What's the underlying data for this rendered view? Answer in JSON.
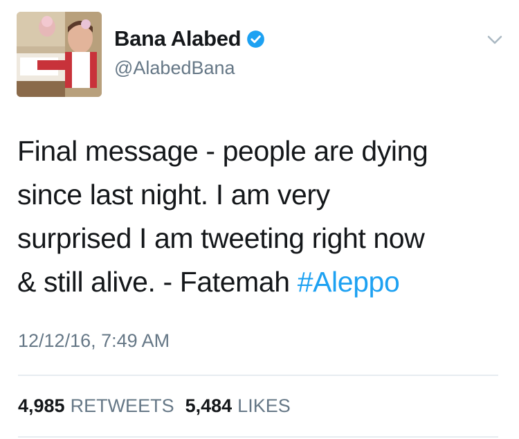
{
  "author": {
    "display_name": "Bana Alabed",
    "handle": "@AlabedBana",
    "verified": true,
    "avatar_icon": "profile-photo"
  },
  "tweet": {
    "lines": [
      "Final message - people are dying",
      "since last night. I am very",
      "surprised I am tweeting right now",
      "& still alive. - Fatemah "
    ],
    "hashtag": "#Aleppo",
    "timestamp": "12/12/16, 7:49 AM"
  },
  "stats": {
    "retweets_count": "4,985",
    "retweets_label": "RETWEETS",
    "likes_count": "5,484",
    "likes_label": "LIKES"
  },
  "colors": {
    "text_primary": "#14171a",
    "text_secondary": "#657786",
    "accent": "#1da1f2",
    "divider": "#e6ecf0"
  }
}
